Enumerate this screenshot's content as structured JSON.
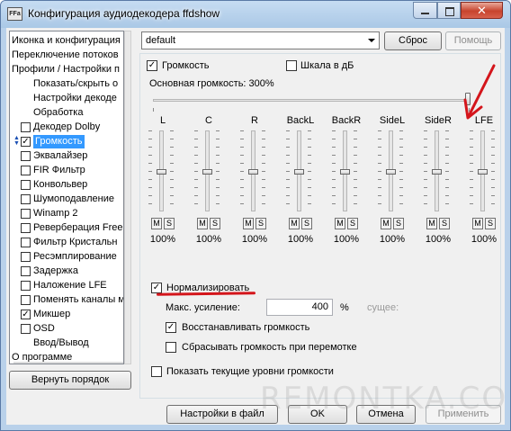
{
  "window": {
    "title": "Конфигурация аудиодекодера ffdshow",
    "icon_text": "FFa",
    "close_glyph": "✕"
  },
  "tree": {
    "items": [
      {
        "label": "Иконка и конфигурация",
        "checkbox": null,
        "indent": 0
      },
      {
        "label": "Переключение потоков",
        "checkbox": null,
        "indent": 0
      },
      {
        "label": "Профили / Настройки п",
        "checkbox": null,
        "indent": 0
      },
      {
        "label": "Показать/скрыть о",
        "checkbox": null,
        "indent": 1
      },
      {
        "label": "Настройки декоде",
        "checkbox": null,
        "indent": 1
      },
      {
        "label": "Обработка",
        "checkbox": null,
        "indent": 1
      },
      {
        "label": "Декодер Dolby",
        "checkbox": false,
        "indent": 1
      },
      {
        "label": "Громкость",
        "checkbox": true,
        "indent": 1,
        "selected": true
      },
      {
        "label": "Эквалайзер",
        "checkbox": false,
        "indent": 1
      },
      {
        "label": "FIR Фильтр",
        "checkbox": false,
        "indent": 1
      },
      {
        "label": "Конвольвер",
        "checkbox": false,
        "indent": 1
      },
      {
        "label": "Шумоподавление",
        "checkbox": false,
        "indent": 1
      },
      {
        "label": "Winamp 2",
        "checkbox": false,
        "indent": 1
      },
      {
        "label": "Реверберация Free",
        "checkbox": false,
        "indent": 1
      },
      {
        "label": "Фильтр Кристальн",
        "checkbox": false,
        "indent": 1
      },
      {
        "label": "Ресэмплирование",
        "checkbox": false,
        "indent": 1
      },
      {
        "label": "Задержка",
        "checkbox": false,
        "indent": 1
      },
      {
        "label": "Наложение LFE",
        "checkbox": false,
        "indent": 1
      },
      {
        "label": "Поменять каналы м",
        "checkbox": false,
        "indent": 1
      },
      {
        "label": "Микшер",
        "checkbox": true,
        "indent": 1
      },
      {
        "label": "OSD",
        "checkbox": false,
        "indent": 1
      },
      {
        "label": "Ввод/Вывод",
        "checkbox": null,
        "indent": 1
      },
      {
        "label": "О программе",
        "checkbox": null,
        "indent": 0
      }
    ]
  },
  "buttons": {
    "restore_order": "Вернуть порядок",
    "reset": "Сброс",
    "help": "Помощь",
    "save_settings": "Настройки в файл",
    "ok": "OK",
    "cancel": "Отмена",
    "apply": "Применить"
  },
  "profile": {
    "selected": "default"
  },
  "volume_page": {
    "volume_label": "Громкость",
    "volume_checked": true,
    "db_scale_label": "Шкала в дБ",
    "db_scale_checked": false,
    "master_label": "Основная громкость: 300%",
    "master_level_fraction": 1.0,
    "channels": [
      {
        "name": "L",
        "value": "100%",
        "mute": "M",
        "solo": "S"
      },
      {
        "name": "C",
        "value": "100%",
        "mute": "M",
        "solo": "S"
      },
      {
        "name": "R",
        "value": "100%",
        "mute": "M",
        "solo": "S"
      },
      {
        "name": "BackL",
        "value": "100%",
        "mute": "M",
        "solo": "S"
      },
      {
        "name": "BackR",
        "value": "100%",
        "mute": "M",
        "solo": "S"
      },
      {
        "name": "SideL",
        "value": "100%",
        "mute": "M",
        "solo": "S"
      },
      {
        "name": "SideR",
        "value": "100%",
        "mute": "M",
        "solo": "S"
      },
      {
        "name": "LFE",
        "value": "100%",
        "mute": "M",
        "solo": "S"
      }
    ],
    "normalize_label": "Нормализировать",
    "normalize_checked": true,
    "max_gain_label": "Макс. усиление:",
    "max_gain_value": "400",
    "percent_sign": "%",
    "current_label": "сущее:",
    "restore_volume_label": "Восстанавливать громкость",
    "restore_volume_checked": true,
    "reset_on_seek_label": "Сбрасывать громкость при перемотке",
    "reset_on_seek_checked": false,
    "show_levels_label": "Показать текущие уровни громкости",
    "show_levels_checked": false
  },
  "watermark": "REMONTKA.COM",
  "colors": {
    "selection": "#3399ff",
    "annotation_red": "#d4151b"
  }
}
